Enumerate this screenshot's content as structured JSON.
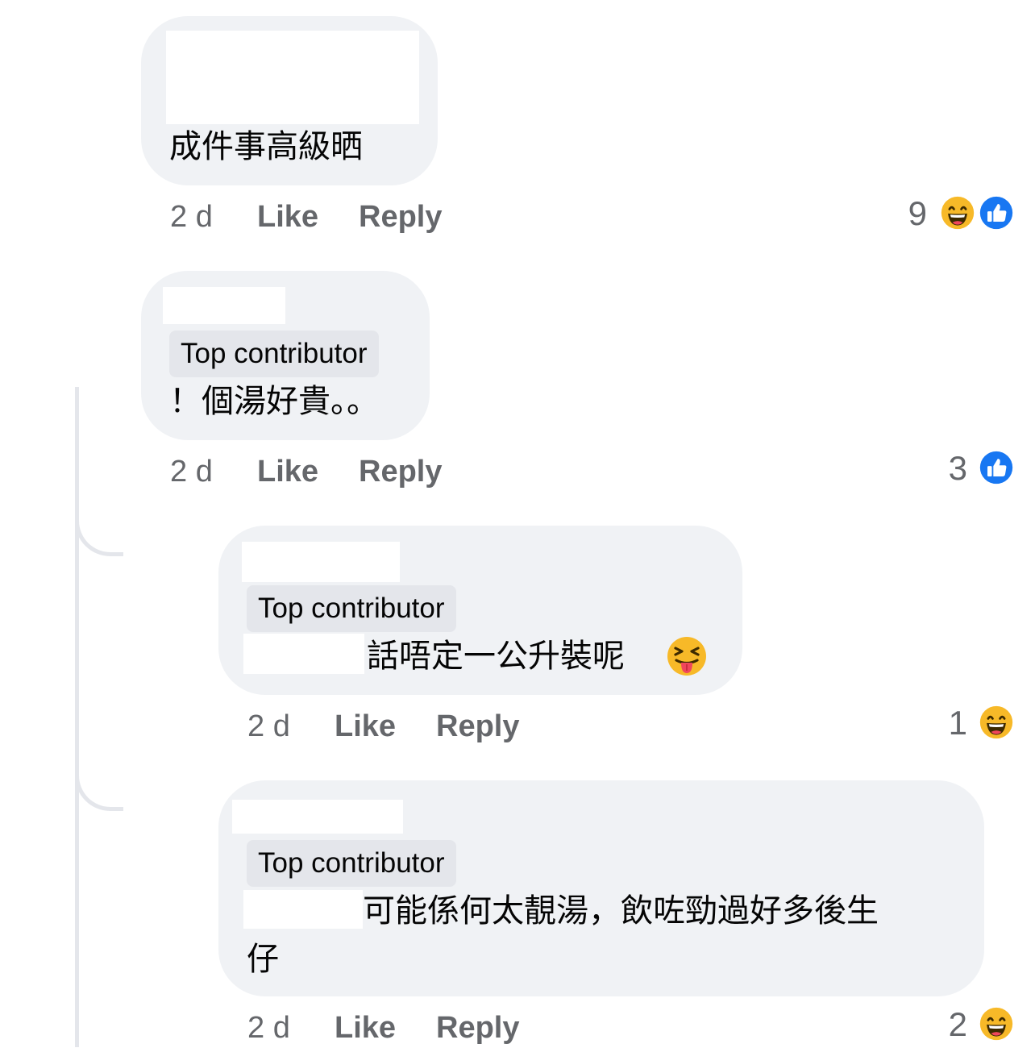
{
  "colors": {
    "bubble": "#f0f2f5",
    "badge": "#e4e6eb",
    "meta": "#65676b",
    "like_blue": "#1877f2",
    "haha_yellow": "#f7b928"
  },
  "comments": [
    {
      "text": "成件事高級晒",
      "time": "2 d",
      "like": "Like",
      "reply": "Reply",
      "reaction_count": "9",
      "reactions": [
        "haha-icon",
        "like-icon"
      ]
    },
    {
      "badge": "Top contributor",
      "text": "！個湯好貴。。",
      "time": "2 d",
      "like": "Like",
      "reply": "Reply",
      "reaction_count": "3",
      "reactions": [
        "like-icon"
      ]
    },
    {
      "badge": "Top contributor",
      "text": "話唔定一公升裝呢",
      "emoji": "squinting-tongue-face",
      "time": "2 d",
      "like": "Like",
      "reply": "Reply",
      "reaction_count": "1",
      "reactions": [
        "haha-icon"
      ]
    },
    {
      "badge": "Top contributor",
      "text_line1": "可能係何太靚湯，飲咗勁過好多後生",
      "text_line2": "仔",
      "time": "2 d",
      "like": "Like",
      "reply": "Reply",
      "reaction_count": "2",
      "reactions": [
        "haha-icon"
      ]
    }
  ]
}
